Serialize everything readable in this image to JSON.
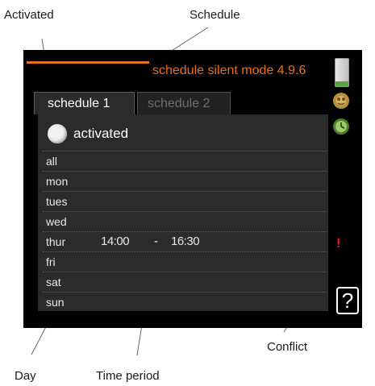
{
  "callouts": {
    "activated": "Activated",
    "schedule": "Schedule",
    "conflict": "Conflict",
    "day": "Day",
    "time_period": "Time period"
  },
  "screen": {
    "title": "schedule silent mode 4.9.6",
    "tabs": [
      {
        "label": "schedule 1",
        "active": true
      },
      {
        "label": "schedule 2",
        "active": false
      }
    ],
    "activated_label": "activated",
    "days": [
      {
        "day": "all",
        "start": "",
        "sep": "",
        "end": "",
        "conflict": ""
      },
      {
        "day": "mon",
        "start": "",
        "sep": "",
        "end": "",
        "conflict": ""
      },
      {
        "day": "tues",
        "start": "",
        "sep": "",
        "end": "",
        "conflict": ""
      },
      {
        "day": "wed",
        "start": "",
        "sep": "",
        "end": "",
        "conflict": ""
      },
      {
        "day": "thur",
        "start": "14:00",
        "sep": "-",
        "end": "16:30",
        "conflict": "!"
      },
      {
        "day": "fri",
        "start": "",
        "sep": "",
        "end": "",
        "conflict": ""
      },
      {
        "day": "sat",
        "start": "",
        "sep": "",
        "end": "",
        "conflict": ""
      },
      {
        "day": "sun",
        "start": "",
        "sep": "",
        "end": "",
        "conflict": ""
      }
    ],
    "help_label": "?",
    "colors": {
      "accent": "#e36f1e",
      "conflict": "#ff1a1a",
      "panel": "#2b2b2b"
    },
    "icons": [
      "level-bar-icon",
      "heat-pump-icon",
      "clock-icon",
      "help-icon"
    ]
  }
}
